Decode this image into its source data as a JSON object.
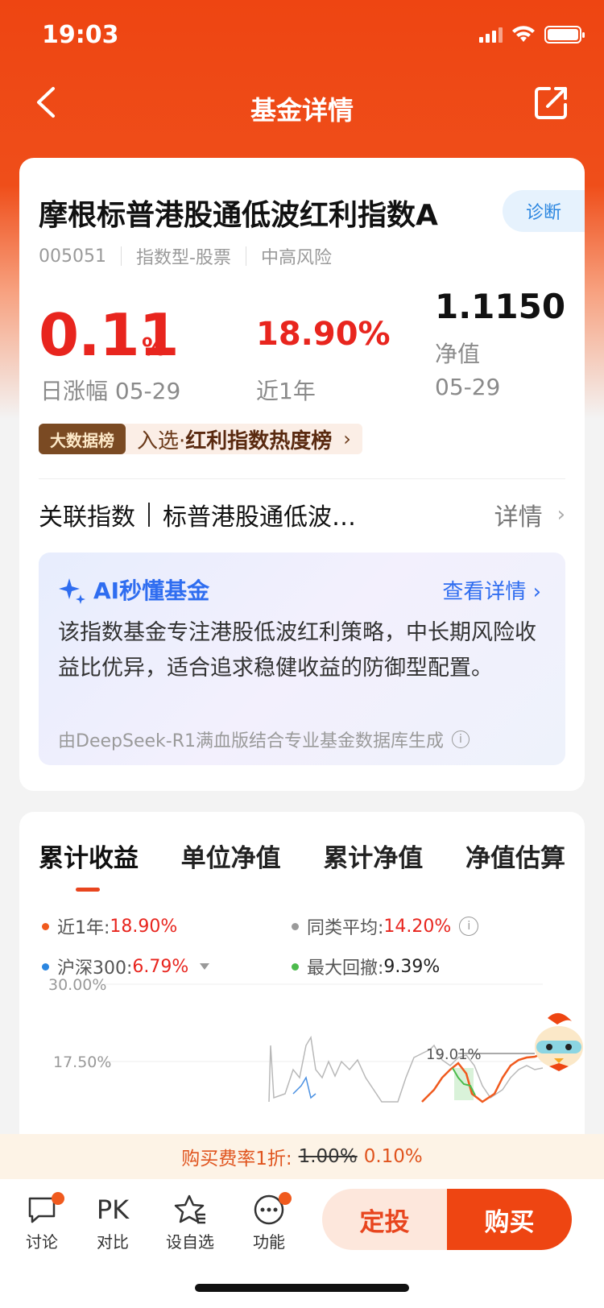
{
  "status": {
    "time": "19:03"
  },
  "nav": {
    "title": "基金详情"
  },
  "fund": {
    "name": "摩根标普港股通低波红利指数A",
    "diagnose": "诊断",
    "code": "005051",
    "type": "指数型-股票",
    "risk": "中高风险",
    "daily_change": "0.11",
    "daily_unit": "%",
    "daily_label": "日涨幅 05-29",
    "year_return": "18.90%",
    "year_label": "近1年",
    "nav_value": "1.1150",
    "nav_label": "净值",
    "nav_date": "05-29"
  },
  "rank": {
    "tag": "大数据榜",
    "prefix": "入选·",
    "name": "红利指数热度榜"
  },
  "index": {
    "label": "关联指数",
    "name": "标普港股通低波…",
    "detail": "详情"
  },
  "ai": {
    "title": "AI秒懂基金",
    "link": "查看详情",
    "body": "该指数基金专注港股低波红利策略，中长期风险收益比优异，适合追求稳健收益的防御型配置。",
    "footer": "由DeepSeek-R1满血版结合专业基金数据库生成"
  },
  "tabs": [
    "累计收益",
    "单位净值",
    "累计净值",
    "净值估算"
  ],
  "legend": {
    "year": {
      "label": "近1年:",
      "value": "18.90%",
      "color": "#f05a1e"
    },
    "peer": {
      "label": "同类平均:",
      "value": "14.20%",
      "color": "#9a9a9a"
    },
    "hs300": {
      "label": "沪深300:",
      "value": "6.79%",
      "color": "#2b86e0"
    },
    "drawdown": {
      "label": "最大回撤:",
      "value": "9.39%",
      "color": "#4cbb4c"
    }
  },
  "chart": {
    "y_labels": [
      "30.00%",
      "17.50%"
    ],
    "annotation": "19.01%"
  },
  "fee": {
    "prefix": "购买费率1折:",
    "old": "1.00%",
    "new": "0.10%"
  },
  "bottom": {
    "discuss": "讨论",
    "compare_icon": "PK",
    "compare": "对比",
    "watch": "设自选",
    "more": "功能",
    "sip": "定投",
    "buy": "购买"
  }
}
